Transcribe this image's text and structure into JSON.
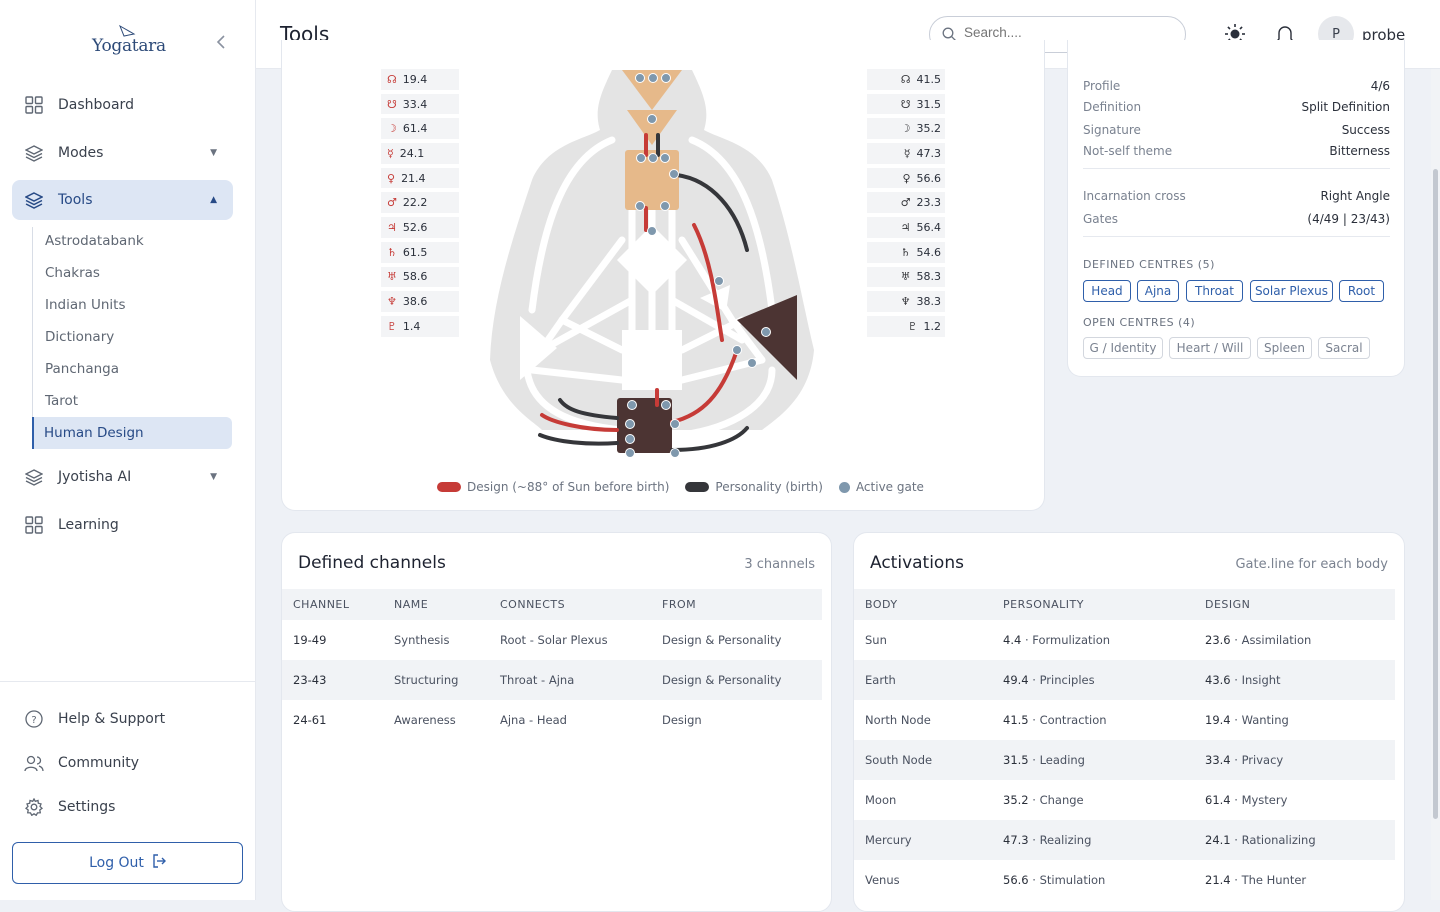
{
  "app": {
    "logo_text": "Yogatara"
  },
  "nav": {
    "items": [
      {
        "label": "Dashboard"
      },
      {
        "label": "Modes"
      },
      {
        "label": "Tools"
      },
      {
        "label": "Jyotisha AI"
      },
      {
        "label": "Learning"
      }
    ],
    "tools_sub": [
      "Astrodatabank",
      "Chakras",
      "Indian Units",
      "Dictionary",
      "Panchanga",
      "Tarot",
      "Human Design"
    ],
    "bottom": [
      {
        "label": "Help & Support"
      },
      {
        "label": "Community"
      },
      {
        "label": "Settings"
      }
    ],
    "logout": "Log Out"
  },
  "header": {
    "title": "Tools",
    "search_placeholder": "Search....",
    "avatar_initial": "P",
    "username": "probe"
  },
  "planets": {
    "symbols": [
      "☊",
      "☋",
      "☽",
      "☿",
      "♀",
      "♂",
      "♃",
      "♄",
      "♅",
      "♆",
      "♇"
    ],
    "design": [
      "19.4",
      "33.4",
      "61.4",
      "24.1",
      "21.4",
      "22.2",
      "52.6",
      "61.5",
      "58.6",
      "38.6",
      "1.4"
    ],
    "personality": [
      "41.5",
      "31.5",
      "35.2",
      "47.3",
      "56.6",
      "23.3",
      "56.4",
      "54.6",
      "58.3",
      "38.3",
      "1.2"
    ]
  },
  "bodygraph": {
    "legend": [
      "Design (~88° of Sun before birth)",
      "Personality (birth)",
      "Active gate"
    ],
    "colors": {
      "design": "#c63b37",
      "personality": "#35363a",
      "active": "#7f98ad",
      "defined_centre": "#e6b98a",
      "root": "#4c3433"
    }
  },
  "info": {
    "rows": [
      {
        "k": "Profile",
        "v": "4/6"
      },
      {
        "k": "Definition",
        "v": "Split Definition"
      },
      {
        "k": "Signature",
        "v": "Success"
      },
      {
        "k": "Not-self theme",
        "v": "Bitterness"
      },
      {
        "k": "Incarnation cross",
        "v": "Right Angle"
      },
      {
        "k": "Gates",
        "v": "(4/49 | 23/43)"
      }
    ],
    "defined_label": "DEFINED CENTRES (5)",
    "defined": [
      "Head",
      "Ajna",
      "Throat",
      "Solar Plexus",
      "Root"
    ],
    "open_label": "OPEN CENTRES (4)",
    "open": [
      "G / Identity",
      "Heart / Will",
      "Spleen",
      "Sacral"
    ]
  },
  "channels": {
    "title": "Defined channels",
    "meta": "3 channels",
    "headers": [
      "CHANNEL",
      "NAME",
      "CONNECTS",
      "FROM"
    ],
    "rows": [
      [
        "19-49",
        "Synthesis",
        "Root - Solar Plexus",
        "Design & Personality"
      ],
      [
        "23-43",
        "Structuring",
        "Throat - Ajna",
        "Design & Personality"
      ],
      [
        "24-61",
        "Awareness",
        "Ajna - Head",
        "Design"
      ]
    ]
  },
  "activations": {
    "title": "Activations",
    "meta": "Gate.line for each body",
    "headers": [
      "BODY",
      "PERSONALITY",
      "DESIGN"
    ],
    "rows": [
      {
        "body": "Sun",
        "p_gate": "4.4",
        "p_name": "· Formulization",
        "d_gate": "23.6",
        "d_name": "· Assimilation"
      },
      {
        "body": "Earth",
        "p_gate": "49.4",
        "p_name": "· Principles",
        "d_gate": "43.6",
        "d_name": "· Insight"
      },
      {
        "body": "North Node",
        "p_gate": "41.5",
        "p_name": "· Contraction",
        "d_gate": "19.4",
        "d_name": "· Wanting"
      },
      {
        "body": "South Node",
        "p_gate": "31.5",
        "p_name": "· Leading",
        "d_gate": "33.4",
        "d_name": "· Privacy"
      },
      {
        "body": "Moon",
        "p_gate": "35.2",
        "p_name": "· Change",
        "d_gate": "61.4",
        "d_name": "· Mystery"
      },
      {
        "body": "Mercury",
        "p_gate": "47.3",
        "p_name": "· Realizing",
        "d_gate": "24.1",
        "d_name": "· Rationalizing"
      },
      {
        "body": "Venus",
        "p_gate": "56.6",
        "p_name": "· Stimulation",
        "d_gate": "21.4",
        "d_name": "· The Hunter"
      }
    ]
  }
}
